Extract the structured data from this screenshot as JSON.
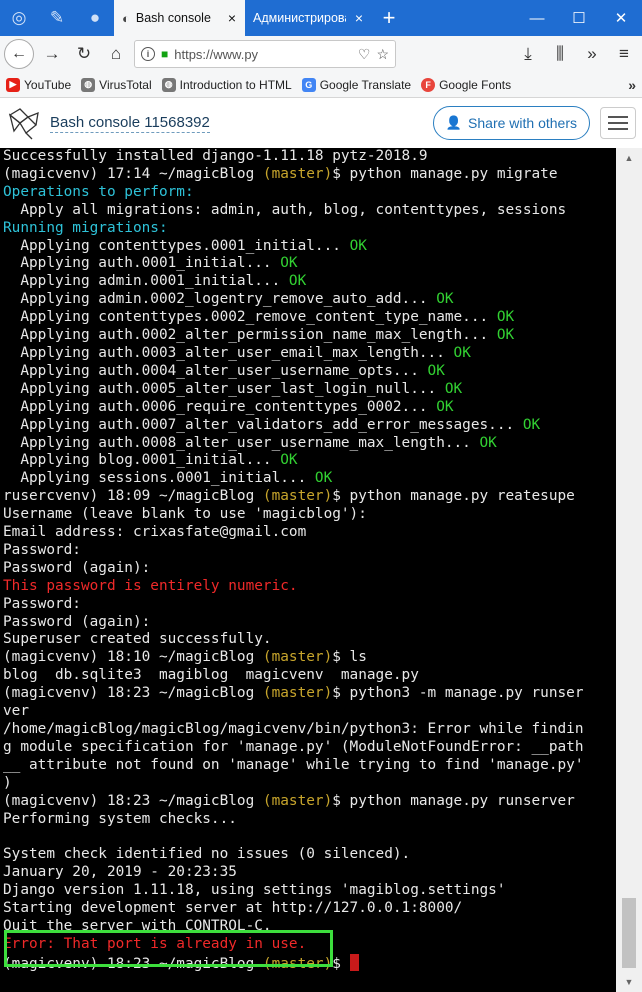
{
  "browser": {
    "tabs": [
      {
        "label": "Bash console",
        "active": true,
        "close": "×"
      },
      {
        "label": "Администрировани",
        "active": false,
        "close": "×"
      }
    ],
    "new_tab": "+",
    "window_controls": {
      "minimize": "—",
      "maximize": "☐",
      "close": "✕"
    },
    "address": "https://www.py",
    "bookmarks": [
      "YouTube",
      "VirusTotal",
      "Introduction to HTML",
      "Google Translate",
      "Google Fonts"
    ],
    "bookmarks_more": "»"
  },
  "header": {
    "console_title": "Bash console 11568392",
    "share_label": "Share with others"
  },
  "terminal": {
    "lines": [
      [
        {
          "t": "Successfully installed django-1.11.18 pytz-2018.9"
        }
      ],
      [
        {
          "t": "(magicvenv) 17:14 ~/magicBlog "
        },
        {
          "t": "(master)",
          "c": "yellow"
        },
        {
          "t": "$ python manage.py migrate"
        }
      ],
      [
        {
          "t": "Operations to perform:",
          "c": "cyan"
        }
      ],
      [
        {
          "t": "  Apply all migrations: admin, auth, blog, contenttypes, sessions"
        }
      ],
      [
        {
          "t": "Running migrations:",
          "c": "cyan"
        }
      ],
      [
        {
          "t": "  Applying contenttypes.0001_initial... "
        },
        {
          "t": "OK",
          "c": "green"
        }
      ],
      [
        {
          "t": "  Applying auth.0001_initial... "
        },
        {
          "t": "OK",
          "c": "green"
        }
      ],
      [
        {
          "t": "  Applying admin.0001_initial... "
        },
        {
          "t": "OK",
          "c": "green"
        }
      ],
      [
        {
          "t": "  Applying admin.0002_logentry_remove_auto_add... "
        },
        {
          "t": "OK",
          "c": "green"
        }
      ],
      [
        {
          "t": "  Applying contenttypes.0002_remove_content_type_name... "
        },
        {
          "t": "OK",
          "c": "green"
        }
      ],
      [
        {
          "t": "  Applying auth.0002_alter_permission_name_max_length... "
        },
        {
          "t": "OK",
          "c": "green"
        }
      ],
      [
        {
          "t": "  Applying auth.0003_alter_user_email_max_length... "
        },
        {
          "t": "OK",
          "c": "green"
        }
      ],
      [
        {
          "t": "  Applying auth.0004_alter_user_username_opts... "
        },
        {
          "t": "OK",
          "c": "green"
        }
      ],
      [
        {
          "t": "  Applying auth.0005_alter_user_last_login_null... "
        },
        {
          "t": "OK",
          "c": "green"
        }
      ],
      [
        {
          "t": "  Applying auth.0006_require_contenttypes_0002... "
        },
        {
          "t": "OK",
          "c": "green"
        }
      ],
      [
        {
          "t": "  Applying auth.0007_alter_validators_add_error_messages... "
        },
        {
          "t": "OK",
          "c": "green"
        }
      ],
      [
        {
          "t": "  Applying auth.0008_alter_user_username_max_length... "
        },
        {
          "t": "OK",
          "c": "green"
        }
      ],
      [
        {
          "t": "  Applying blog.0001_initial... "
        },
        {
          "t": "OK",
          "c": "green"
        }
      ],
      [
        {
          "t": "  Applying sessions.0001_initial... "
        },
        {
          "t": "OK",
          "c": "green"
        }
      ],
      [
        {
          "t": "rusercvenv) 18:09 ~/magicBlog "
        },
        {
          "t": "(master)",
          "c": "yellow"
        },
        {
          "t": "$ python manage.py reatesupe"
        }
      ],
      [
        {
          "t": "Username (leave blank to use 'magicblog'):"
        }
      ],
      [
        {
          "t": "Email address: crixasfate@gmail.com"
        }
      ],
      [
        {
          "t": "Password:"
        }
      ],
      [
        {
          "t": "Password (again):"
        }
      ],
      [
        {
          "t": "This password is entirely numeric.",
          "c": "red"
        }
      ],
      [
        {
          "t": "Password:"
        }
      ],
      [
        {
          "t": "Password (again):"
        }
      ],
      [
        {
          "t": "Superuser created successfully."
        }
      ],
      [
        {
          "t": "(magicvenv) 18:10 ~/magicBlog "
        },
        {
          "t": "(master)",
          "c": "yellow"
        },
        {
          "t": "$ ls"
        }
      ],
      [
        {
          "t": "blog  db.sqlite3  magiblog  magicvenv  manage.py"
        }
      ],
      [
        {
          "t": "(magicvenv) 18:23 ~/magicBlog "
        },
        {
          "t": "(master)",
          "c": "yellow"
        },
        {
          "t": "$ python3 -m manage.py runser"
        }
      ],
      [
        {
          "t": "ver"
        }
      ],
      [
        {
          "t": "/home/magicBlog/magicBlog/magicvenv/bin/python3: Error while findin"
        }
      ],
      [
        {
          "t": "g module specification for 'manage.py' (ModuleNotFoundError: __path"
        }
      ],
      [
        {
          "t": "__ attribute not found on 'manage' while trying to find 'manage.py'"
        }
      ],
      [
        {
          "t": ")"
        }
      ],
      [
        {
          "t": "(magicvenv) 18:23 ~/magicBlog "
        },
        {
          "t": "(master)",
          "c": "yellow"
        },
        {
          "t": "$ python manage.py runserver"
        }
      ],
      [
        {
          "t": "Performing system checks..."
        }
      ],
      [
        {
          "t": ""
        }
      ],
      [
        {
          "t": "System check identified no issues (0 silenced)."
        }
      ],
      [
        {
          "t": "January 20, 2019 - 20:23:35"
        }
      ],
      [
        {
          "t": "Django version 1.11.18, using settings 'magiblog.settings'"
        }
      ],
      [
        {
          "t": "Starting development server at http://127.0.0.1:8000/"
        }
      ],
      [
        {
          "t": "Quit the server with CONTROL-C."
        }
      ],
      [
        {
          "t": "Error: That port is already in use.",
          "c": "red"
        }
      ],
      [
        {
          "t": "(magicvenv) 18:23 ~/magicBlog "
        },
        {
          "t": "(master)",
          "c": "yellow"
        },
        {
          "t": "$ "
        },
        {
          "cursor": true
        }
      ]
    ]
  },
  "colors": {
    "tab_bar": "#1f6dd2",
    "terminal_bg": "#000000",
    "cyan": "#2ec2d8",
    "green": "#32d132",
    "yellow": "#c7a52c",
    "red": "#ef2929",
    "highlight": "#3dde3d"
  },
  "icons": [
    "firefox-icon",
    "pin-icon",
    "github-icon",
    "back-arrow-icon",
    "reload-icon",
    "home-icon",
    "info-icon",
    "lock-icon",
    "pocket-icon",
    "star-icon",
    "download-icon",
    "overflow-icon",
    "menu-icon",
    "user-plus-icon"
  ]
}
